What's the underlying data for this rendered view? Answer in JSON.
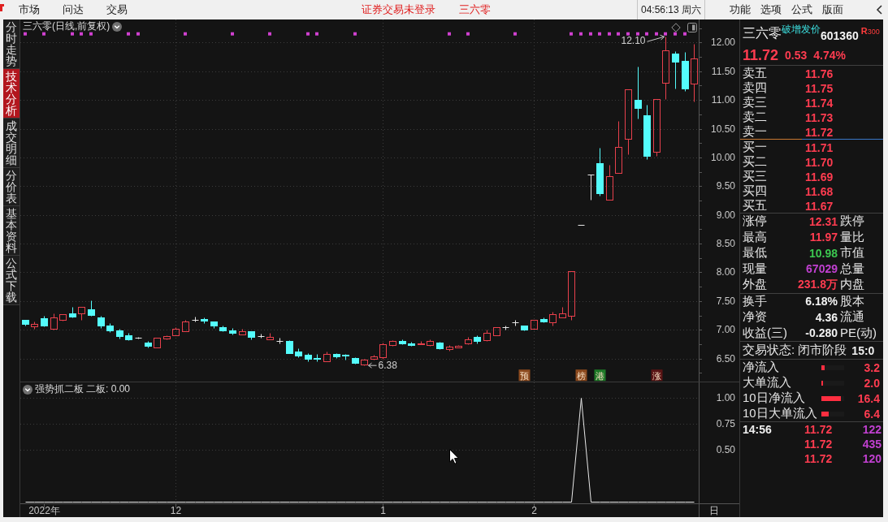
{
  "menu_bar": {
    "items": [
      "市场",
      "问达",
      "交易"
    ],
    "login_status": "证券交易未登录",
    "stock_name": "三六零",
    "clock": "04:56:13 周六",
    "tools": [
      "功能",
      "选项",
      "公式",
      "版面"
    ]
  },
  "side_tabs": [
    {
      "label": "分时走势",
      "selected": false
    },
    {
      "label": "技术分析",
      "selected": true
    },
    {
      "label": "成交明细",
      "selected": false
    },
    {
      "label": "分价表",
      "selected": false
    },
    {
      "label": "基本资料",
      "selected": false
    },
    {
      "label": "公式下载",
      "selected": false
    }
  ],
  "main_chart": {
    "title": "三六零(日线,前复权)",
    "chart_data": [
      {
        "type": "candlestick",
        "ylim": [
          6.1,
          12.4
        ],
        "yticks": [
          {
            "value": 6.5,
            "label": "6.50"
          },
          {
            "value": 7,
            "label": "7.00"
          },
          {
            "value": 7.5,
            "label": "7.50"
          },
          {
            "value": 8,
            "label": "8.00"
          },
          {
            "value": 8.5,
            "label": "8.50"
          },
          {
            "value": 9,
            "label": "9.00"
          },
          {
            "value": 9.5,
            "label": "9.50"
          },
          {
            "value": 10,
            "label": "10.00"
          },
          {
            "value": 10.5,
            "label": "10.50"
          },
          {
            "value": 11,
            "label": "11.00"
          },
          {
            "value": 11.5,
            "label": "11.50"
          },
          {
            "value": 12,
            "label": "12.00"
          }
        ],
        "tick_labels": "y",
        "grid": true,
        "ohlc": [
          [
            7.17,
            7.18,
            7.08,
            7.1
          ],
          [
            7.06,
            7.14,
            7.02,
            7.1
          ],
          [
            7.2,
            7.24,
            7.06,
            7.07
          ],
          [
            7.02,
            7.28,
            7.0,
            7.22
          ],
          [
            7.18,
            7.27,
            7.16,
            7.27
          ],
          [
            7.28,
            7.4,
            7.21,
            7.23
          ],
          [
            7.28,
            7.4,
            7.18,
            7.4
          ],
          [
            7.36,
            7.51,
            7.25,
            7.26
          ],
          [
            7.22,
            7.25,
            7.03,
            7.07
          ],
          [
            7.07,
            7.12,
            6.96,
            6.99
          ],
          [
            6.99,
            7.02,
            6.85,
            6.89
          ],
          [
            6.9,
            6.95,
            6.82,
            6.84
          ],
          [
            6.86,
            6.88,
            6.85,
            6.86
          ],
          [
            6.78,
            6.81,
            6.69,
            6.72
          ],
          [
            6.7,
            6.86,
            6.7,
            6.86
          ],
          [
            6.85,
            6.9,
            6.84,
            6.89
          ],
          [
            6.91,
            7.04,
            6.91,
            7.02
          ],
          [
            6.98,
            7.18,
            6.97,
            7.15
          ],
          [
            7.18,
            7.23,
            7.14,
            7.18
          ],
          [
            7.19,
            7.22,
            7.12,
            7.16
          ],
          [
            7.14,
            7.15,
            7.03,
            7.08
          ],
          [
            7.05,
            7.07,
            6.97,
            6.99
          ],
          [
            6.99,
            7.03,
            6.92,
            6.95
          ],
          [
            6.92,
            7.02,
            6.92,
            6.98
          ],
          [
            6.97,
            6.98,
            6.84,
            6.87
          ],
          [
            6.89,
            6.93,
            6.86,
            6.89
          ],
          [
            6.83,
            6.95,
            6.83,
            6.88
          ],
          [
            6.81,
            6.86,
            6.76,
            6.81
          ],
          [
            6.81,
            6.82,
            6.59,
            6.6
          ],
          [
            6.62,
            6.68,
            6.52,
            6.55
          ],
          [
            6.56,
            6.59,
            6.45,
            6.49
          ],
          [
            6.51,
            6.58,
            6.46,
            6.49
          ],
          [
            6.46,
            6.62,
            6.46,
            6.58
          ],
          [
            6.58,
            6.59,
            6.51,
            6.54
          ],
          [
            6.57,
            6.58,
            6.48,
            6.55
          ],
          [
            6.51,
            6.53,
            6.41,
            6.42
          ],
          [
            6.4,
            6.49,
            6.38,
            6.48
          ],
          [
            6.5,
            6.56,
            6.48,
            6.54
          ],
          [
            6.52,
            6.78,
            6.5,
            6.75
          ],
          [
            6.74,
            6.82,
            6.72,
            6.8
          ],
          [
            6.81,
            6.83,
            6.75,
            6.77
          ],
          [
            6.77,
            6.79,
            6.72,
            6.74
          ],
          [
            6.75,
            6.81,
            6.75,
            6.77
          ],
          [
            6.74,
            6.83,
            6.72,
            6.8
          ],
          [
            6.78,
            6.79,
            6.67,
            6.68
          ],
          [
            6.67,
            6.74,
            6.63,
            6.71
          ],
          [
            6.7,
            6.73,
            6.69,
            6.72
          ],
          [
            6.76,
            6.87,
            6.75,
            6.84
          ],
          [
            6.87,
            6.9,
            6.77,
            6.81
          ],
          [
            6.82,
            7.0,
            6.8,
            6.95
          ],
          [
            6.9,
            7.05,
            6.9,
            7.05
          ],
          [
            7.04,
            7.08,
            7.0,
            7.04
          ],
          [
            7.13,
            7.17,
            7.08,
            7.13
          ],
          [
            7.07,
            7.08,
            6.99,
            7.01
          ],
          [
            7.02,
            7.18,
            7.02,
            7.18
          ],
          [
            7.19,
            7.22,
            7.13,
            7.15
          ],
          [
            7.13,
            7.31,
            7.07,
            7.27
          ],
          [
            7.22,
            7.4,
            7.22,
            7.29
          ],
          [
            7.25,
            8.02,
            7.18,
            8.02
          ],
          [
            8.82,
            8.82,
            8.82,
            8.82
          ],
          [
            9.7,
            9.7,
            9.27,
            9.7
          ],
          [
            9.9,
            10.17,
            9.33,
            9.38
          ],
          [
            9.26,
            9.87,
            9.26,
            9.68
          ],
          [
            9.73,
            10.64,
            9.73,
            10.18
          ],
          [
            10.33,
            11.19,
            10.06,
            11.19
          ],
          [
            11.0,
            11.58,
            10.68,
            10.86
          ],
          [
            10.73,
            10.91,
            9.97,
            10.02
          ],
          [
            10.1,
            11.01,
            10.03,
            11.01
          ],
          [
            11.3,
            12.1,
            11.01,
            11.87
          ],
          [
            11.8,
            11.85,
            11.2,
            11.66
          ],
          [
            11.68,
            11.83,
            11.15,
            11.2
          ],
          [
            11.29,
            11.97,
            10.98,
            11.72
          ]
        ],
        "series": [
          {
            "type": "scatter",
            "marker": "square",
            "color": "#d040d0",
            "values": [
              12.15,
              null,
              12.15,
              null,
              null,
              12.15,
              12.15,
              12.15,
              null,
              null,
              null,
              12.15,
              12.15,
              null,
              null,
              null,
              null,
              12.15,
              null,
              null,
              null,
              null,
              12.15,
              null,
              null,
              null,
              12.15,
              null,
              null,
              null,
              12.15,
              12.15,
              null,
              null,
              null,
              12.15,
              null,
              null,
              null,
              null,
              null,
              null,
              null,
              null,
              null,
              12.15,
              null,
              12.15,
              null,
              null,
              null,
              null,
              12.15,
              null,
              null,
              null,
              null,
              null,
              12.15,
              12.15,
              12.15,
              12.15,
              12.15,
              12.15,
              12.15,
              12.15,
              12.15,
              12.15,
              12.15,
              12.15,
              12.15,
              null
            ]
          },
          {
            "type": "scatter",
            "marker": "square",
            "name": "预",
            "color": "#8c4a1e",
            "values": [
              null,
              null,
              null,
              null,
              null,
              null,
              null,
              null,
              null,
              null,
              null,
              null,
              null,
              null,
              null,
              null,
              null,
              null,
              null,
              null,
              null,
              null,
              null,
              null,
              null,
              null,
              null,
              null,
              null,
              null,
              null,
              null,
              null,
              null,
              null,
              null,
              null,
              null,
              null,
              null,
              null,
              null,
              null,
              null,
              null,
              null,
              null,
              null,
              null,
              null,
              null,
              null,
              null,
              6.21,
              null,
              null,
              null,
              null,
              null,
              null,
              null,
              null,
              null,
              null,
              null,
              null,
              null,
              null,
              null,
              null,
              null,
              null
            ]
          },
          {
            "type": "scatter",
            "marker": "square",
            "name": "榜",
            "color": "#8c4a1e",
            "values": [
              null,
              null,
              null,
              null,
              null,
              null,
              null,
              null,
              null,
              null,
              null,
              null,
              null,
              null,
              null,
              null,
              null,
              null,
              null,
              null,
              null,
              null,
              null,
              null,
              null,
              null,
              null,
              null,
              null,
              null,
              null,
              null,
              null,
              null,
              null,
              null,
              null,
              null,
              null,
              null,
              null,
              null,
              null,
              null,
              null,
              null,
              null,
              null,
              null,
              null,
              null,
              null,
              null,
              null,
              null,
              null,
              null,
              null,
              null,
              6.21,
              null,
              null,
              null,
              null,
              null,
              null,
              null,
              null,
              null,
              null,
              null,
              null
            ]
          },
          {
            "type": "scatter",
            "marker": "square",
            "name": "港",
            "color": "#1e7a28",
            "values": [
              null,
              null,
              null,
              null,
              null,
              null,
              null,
              null,
              null,
              null,
              null,
              null,
              null,
              null,
              null,
              null,
              null,
              null,
              null,
              null,
              null,
              null,
              null,
              null,
              null,
              null,
              null,
              null,
              null,
              null,
              null,
              null,
              null,
              null,
              null,
              null,
              null,
              null,
              null,
              null,
              null,
              null,
              null,
              null,
              null,
              null,
              null,
              null,
              null,
              null,
              null,
              null,
              null,
              null,
              null,
              null,
              null,
              null,
              null,
              null,
              null,
              6.21,
              null,
              null,
              null,
              null,
              null,
              null,
              null,
              null,
              null,
              null
            ]
          },
          {
            "type": "scatter",
            "marker": "square",
            "name": "涨",
            "color": "#5a1414",
            "values": [
              null,
              null,
              null,
              null,
              null,
              null,
              null,
              null,
              null,
              null,
              null,
              null,
              null,
              null,
              null,
              null,
              null,
              null,
              null,
              null,
              null,
              null,
              null,
              null,
              null,
              null,
              null,
              null,
              null,
              null,
              null,
              null,
              null,
              null,
              null,
              null,
              null,
              null,
              null,
              null,
              null,
              null,
              null,
              null,
              null,
              null,
              null,
              null,
              null,
              null,
              null,
              null,
              null,
              null,
              null,
              null,
              null,
              null,
              null,
              null,
              null,
              null,
              null,
              null,
              null,
              null,
              null,
              6.21,
              null,
              null,
              null,
              null
            ]
          }
        ],
        "annotations": [
          "12.10",
          "6.38"
        ]
      }
    ]
  },
  "indicator": {
    "name": "强势抓二板",
    "reading": "二板: 0.00",
    "period_label": "日",
    "chart_data": [
      {
        "type": "line",
        "color": "#e8e8e8",
        "ylim": [
          -0.0117,
          1.1523
        ],
        "yticks": [
          {
            "value": 0.5,
            "label": "0.50"
          },
          {
            "value": 0.75,
            "label": "0.75"
          },
          {
            "value": 1,
            "label": "1.00"
          }
        ],
        "grid": true,
        "categories": [
          null,
          null,
          "2022年",
          null,
          null,
          null,
          null,
          null,
          null,
          null,
          null,
          null,
          null,
          null,
          null,
          null,
          "12",
          null,
          null,
          null,
          null,
          null,
          null,
          null,
          null,
          null,
          null,
          null,
          null,
          null,
          null,
          null,
          null,
          null,
          null,
          null,
          null,
          null,
          "1",
          null,
          null,
          null,
          null,
          null,
          null,
          null,
          null,
          null,
          null,
          null,
          null,
          null,
          null,
          null,
          "2",
          null,
          null,
          null,
          null,
          null,
          null,
          null,
          null,
          null,
          null,
          null,
          null,
          null,
          null,
          null,
          null,
          null
        ],
        "values": [
          0,
          0,
          0,
          0,
          0,
          0,
          0,
          0,
          0,
          0,
          0,
          0,
          0,
          0,
          0,
          0,
          0,
          0,
          0,
          0,
          0,
          0,
          0,
          0,
          0,
          0,
          0,
          0,
          0,
          0,
          0,
          0,
          0,
          0,
          0,
          0,
          0,
          0,
          0,
          0,
          0,
          0,
          0,
          0,
          0,
          0,
          0,
          0,
          0,
          0,
          0,
          0,
          0,
          0,
          0,
          0,
          0,
          0,
          0,
          1,
          0,
          0,
          0,
          0,
          0,
          0,
          0,
          0,
          0,
          0,
          0,
          0
        ]
      }
    ]
  },
  "quote": {
    "name": "三六零",
    "tag": "破增发价",
    "code": "601360",
    "badge": "**R**300",
    "price": "11.72",
    "change": "0.53",
    "change_pct": "4.74%",
    "asks": [
      {
        "label": "卖五",
        "price": "11.76"
      },
      {
        "label": "卖四",
        "price": "11.75"
      },
      {
        "label": "卖三",
        "price": "11.74"
      },
      {
        "label": "卖二",
        "price": "11.73"
      },
      {
        "label": "卖一",
        "price": "11.72"
      }
    ],
    "bids": [
      {
        "label": "买一",
        "price": "11.71"
      },
      {
        "label": "买二",
        "price": "11.70"
      },
      {
        "label": "买三",
        "price": "11.69"
      },
      {
        "label": "买四",
        "price": "11.68"
      },
      {
        "label": "买五",
        "price": "11.67"
      }
    ],
    "stats": [
      {
        "label": "涨停",
        "value": "12.31",
        "color": "#ff3c50",
        "label_2": "跌停"
      },
      {
        "label": "最高",
        "value": "11.97",
        "color": "#ff3c50",
        "label_2": "量比"
      },
      {
        "label": "最低",
        "value": "10.98",
        "color": "#3cc850",
        "label_2": "市值"
      },
      {
        "label": "现量",
        "value": "67029",
        "color": "#c040d0",
        "label_2": "总量"
      },
      {
        "label": "外盘",
        "value": "231.8万",
        "color": "#ff3c50",
        "label_2": "内盘"
      }
    ],
    "fundamentals": [
      {
        "label": "换手",
        "value": "6.18%",
        "label_2": "股本"
      },
      {
        "label": "净资",
        "value": "4.36",
        "label_2": "流通"
      },
      {
        "label": "收益(三)",
        "value": "-0.280",
        "label_2": "PE(动)"
      }
    ],
    "trade_status": {
      "text": "交易状态: 闭市阶段",
      "time": "15:0"
    },
    "flows": [
      {
        "label": "净流入",
        "level": 0.14,
        "value": "3.2"
      },
      {
        "label": "大单流入",
        "level": 0.07,
        "value": "2.0"
      },
      {
        "label": "10日净流入",
        "level": 0.86,
        "value": "16.4"
      },
      {
        "label": "10日大单流入",
        "level": 0.32,
        "value": "6.4"
      }
    ],
    "ticks": [
      {
        "time": "14:56",
        "price": "11.72",
        "volume": "122"
      },
      {
        "price": "11.72",
        "volume": "435"
      },
      {
        "price": "11.72",
        "volume": "120"
      }
    ]
  }
}
